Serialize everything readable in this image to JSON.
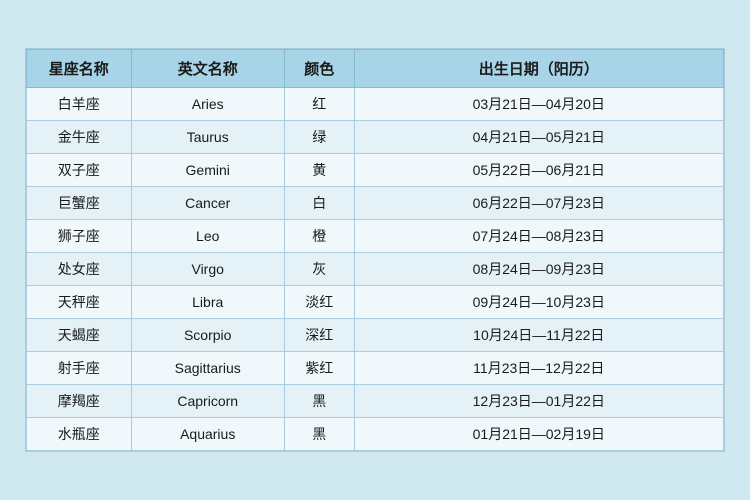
{
  "table": {
    "headers": [
      "星座名称",
      "英文名称",
      "颜色",
      "出生日期（阳历）"
    ],
    "rows": [
      {
        "chinese": "白羊座",
        "english": "Aries",
        "color": "红",
        "date": "03月21日—04月20日"
      },
      {
        "chinese": "金牛座",
        "english": "Taurus",
        "color": "绿",
        "date": "04月21日—05月21日"
      },
      {
        "chinese": "双子座",
        "english": "Gemini",
        "color": "黄",
        "date": "05月22日—06月21日"
      },
      {
        "chinese": "巨蟹座",
        "english": "Cancer",
        "color": "白",
        "date": "06月22日—07月23日"
      },
      {
        "chinese": "狮子座",
        "english": "Leo",
        "color": "橙",
        "date": "07月24日—08月23日"
      },
      {
        "chinese": "处女座",
        "english": "Virgo",
        "color": "灰",
        "date": "08月24日—09月23日"
      },
      {
        "chinese": "天秤座",
        "english": "Libra",
        "color": "淡红",
        "date": "09月24日—10月23日"
      },
      {
        "chinese": "天蝎座",
        "english": "Scorpio",
        "color": "深红",
        "date": "10月24日—11月22日"
      },
      {
        "chinese": "射手座",
        "english": "Sagittarius",
        "color": "紫红",
        "date": "11月23日—12月22日"
      },
      {
        "chinese": "摩羯座",
        "english": "Capricorn",
        "color": "黑",
        "date": "12月23日—01月22日"
      },
      {
        "chinese": "水瓶座",
        "english": "Aquarius",
        "color": "黑",
        "date": "01月21日—02月19日"
      }
    ]
  }
}
